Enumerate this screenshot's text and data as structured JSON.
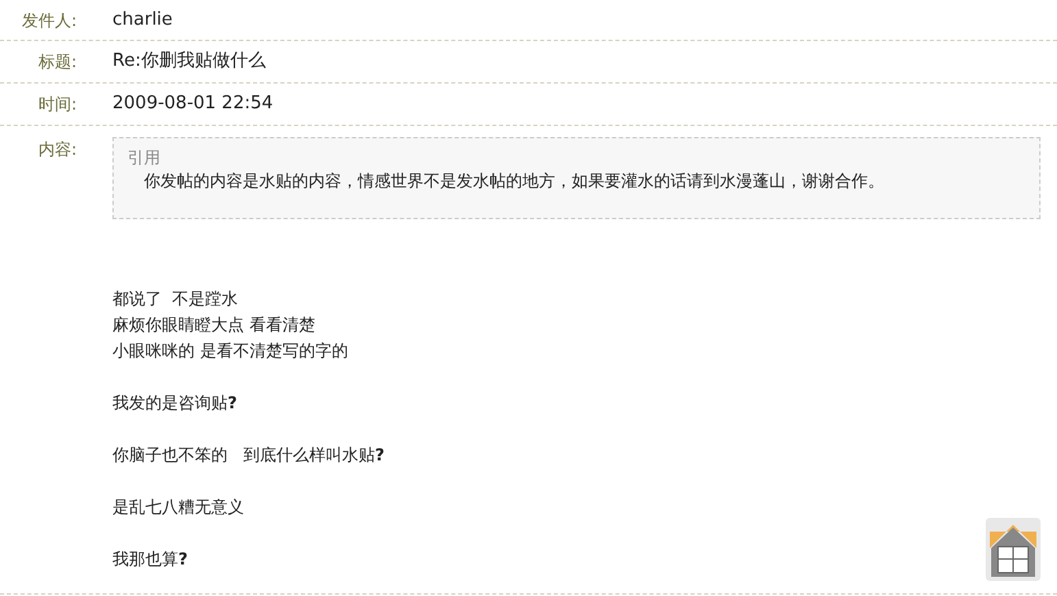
{
  "fields": [
    {
      "label": "发件人:",
      "value": "charlie"
    },
    {
      "label": "标题:",
      "value": "Re:你删我贴做什么"
    },
    {
      "label": "时间:",
      "value": "2009-08-01 22:54"
    }
  ],
  "content": {
    "label": "内容:",
    "quote": {
      "title": "引用",
      "text": "你发帖的内容是水贴的内容，情感世界不是发水帖的地方，如果要灌水的话请到水漫蓬山，谢谢合作。"
    },
    "paragraphs": [
      [
        "都说了  不是蹚水",
        "麻烦你眼睛瞪大点 看看清楚",
        "小眼咪咪的 是看不清楚写的字的"
      ],
      [
        "我发的是咨询贴**?**"
      ],
      [
        "你脑子也不笨的   到底什么样叫水贴**?**"
      ],
      [
        "是乱七八糟无意义"
      ],
      [
        "我那也算**?**"
      ]
    ]
  }
}
